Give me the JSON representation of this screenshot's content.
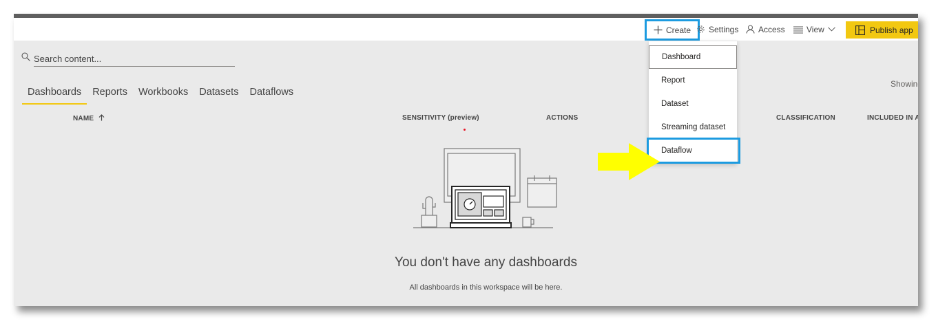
{
  "toolbar": {
    "create_label": "Create",
    "settings_label": "Settings",
    "access_label": "Access",
    "view_label": "View",
    "publish_label": "Publish app"
  },
  "search": {
    "placeholder": "Search content..."
  },
  "tabs": [
    {
      "label": "Dashboards",
      "active": true
    },
    {
      "label": "Reports"
    },
    {
      "label": "Workbooks"
    },
    {
      "label": "Datasets"
    },
    {
      "label": "Dataflows"
    }
  ],
  "showing_text": "Showing",
  "columns": {
    "name": "NAME",
    "sensitivity": "SENSITIVITY (preview)",
    "actions": "ACTIONS",
    "classification": "CLASSIFICATION",
    "included": "INCLUDED IN APP"
  },
  "empty_state": {
    "title": "You don't have any dashboards",
    "subtitle": "All dashboards in this workspace will be here."
  },
  "create_menu": [
    "Dashboard",
    "Report",
    "Dataset",
    "Streaming dataset",
    "Dataflow"
  ],
  "colors": {
    "accent": "#f2c811",
    "highlight": "#1c9be0",
    "arrow": "#ffff00"
  }
}
